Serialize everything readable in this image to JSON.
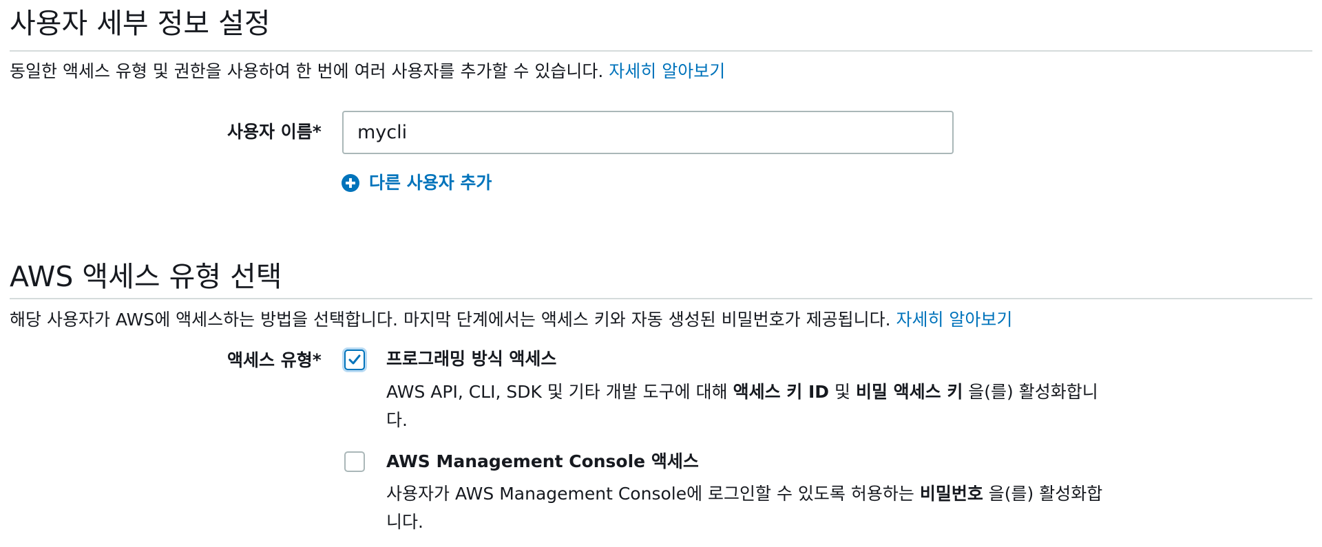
{
  "user_details": {
    "title": "사용자 세부 정보 설정",
    "description": "동일한 액세스 유형 및 권한을 사용하여 한 번에 여러 사용자를 추가할 수 있습니다.",
    "learn_more": "자세히 알아보기",
    "username_label": "사용자 이름*",
    "username_value": "mycli",
    "add_user_label": "다른 사용자 추가"
  },
  "access_type": {
    "title": "AWS 액세스 유형 선택",
    "description": "해당 사용자가 AWS에 액세스하는 방법을 선택합니다. 마지막 단계에서는 액세스 키와 자동 생성된 비밀번호가 제공됩니다.",
    "learn_more": "자세히 알아보기",
    "label": "액세스 유형*",
    "options": [
      {
        "title": "프로그래밍 방식 액세스",
        "checked": true,
        "desc_pre": "AWS API, CLI, SDK 및 기타 개발 도구에 대해 ",
        "desc_bold1": "액세스 키 ID",
        "desc_mid": " 및 ",
        "desc_bold2": "비밀 액세스 키",
        "desc_post": " 을(를) 활성화합니다."
      },
      {
        "title": "AWS Management Console 액세스",
        "checked": false,
        "desc_pre": "사용자가 AWS Management Console에 로그인할 수 있도록 허용하는 ",
        "desc_bold1": "비밀번호",
        "desc_post": " 을(를) 활성화합니다."
      }
    ]
  },
  "colors": {
    "link": "#0073bb",
    "text": "#16191f",
    "divider": "#d5dbdb",
    "input_border": "#aab7b8"
  },
  "icons": {
    "add_user": "plus-circle-icon",
    "checkmark": "checkmark-icon"
  }
}
